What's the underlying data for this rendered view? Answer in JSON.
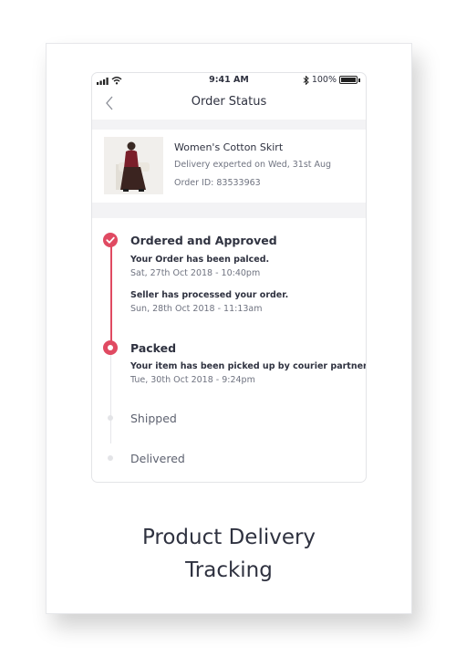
{
  "status_bar": {
    "time": "9:41 AM",
    "battery": "100%"
  },
  "header": {
    "title": "Order Status",
    "back_icon": "chevron-left-icon"
  },
  "product": {
    "name": "Women's Cotton Skirt",
    "delivery": "Delivery experted on Wed, 31st Aug",
    "order_id": "Order ID: 83533963"
  },
  "timeline": [
    {
      "title": "Ordered and Approved",
      "status": "completed",
      "events": [
        {
          "text": "Your Order has been palced.",
          "date": "Sat, 27th Oct 2018 - 10:40pm"
        },
        {
          "text": "Seller has processed your order.",
          "date": "Sun, 28th Oct 2018 - 11:13am"
        }
      ]
    },
    {
      "title": "Packed",
      "status": "current",
      "events": [
        {
          "text": "Your item has been picked up by courier partner.",
          "date": "Tue, 30th Oct 2018 - 9:24pm"
        }
      ]
    },
    {
      "title": "Shipped",
      "status": "pending",
      "events": []
    },
    {
      "title": "Delivered",
      "status": "pending",
      "events": []
    }
  ],
  "caption": {
    "line1": "Product Delivery",
    "line2": "Tracking"
  },
  "colors": {
    "accent": "#e04a62",
    "text": "#2f3240",
    "muted": "#6f7380",
    "divider": "#f3f3f5"
  }
}
